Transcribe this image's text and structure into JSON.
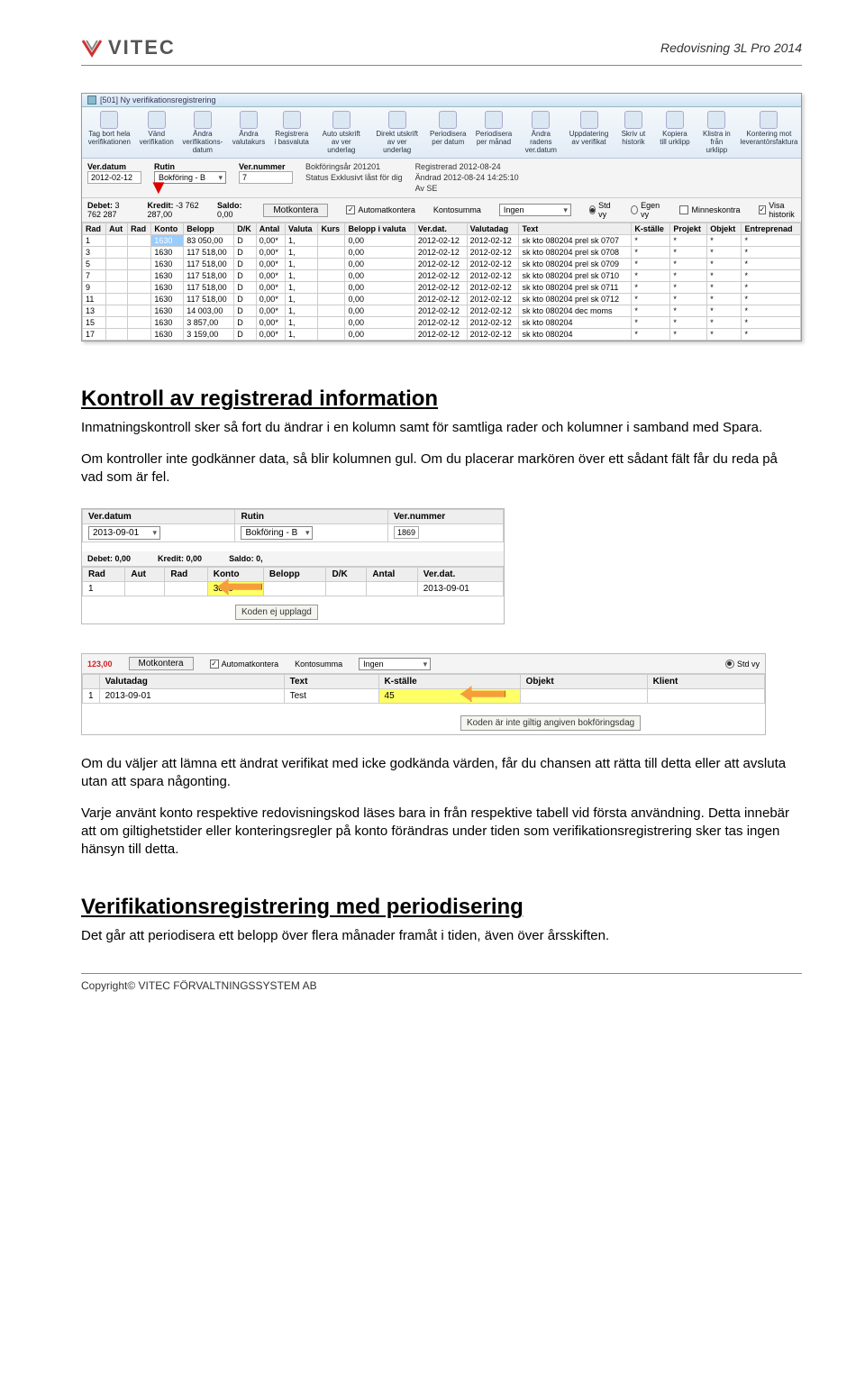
{
  "header": {
    "logo_text": "VITEC",
    "doc_title": "Redovisning 3L Pro 2014"
  },
  "screenshot1": {
    "window_title": "[501] Ny verifikationsregistrering",
    "toolbar": [
      "Tag bort hela verifikationen",
      "Vänd verifikation",
      "Ändra verifikations-datum",
      "Ändra valutakurs",
      "Registrera i basvaluta",
      "Auto utskrift av ver underlag",
      "Direkt utskrift av ver underlag",
      "Periodisera per datum",
      "Periodisera per månad",
      "Ändra radens ver.datum",
      "Uppdatering av verifikat",
      "Skriv ut historik",
      "Kopiera till urklipp",
      "Klistra in från urklipp",
      "Kontering mot leverantörsfaktura"
    ],
    "form": {
      "verdatum_label": "Ver.datum",
      "verdatum": "2012-02-12",
      "rutin_label": "Rutin",
      "rutin": "Bokföring - B",
      "vernummer_label": "Ver.nummer",
      "vernummer": "7",
      "bokforingsar_label": "Bokföringsår",
      "bokforingsar": "201201",
      "status_label": "Status",
      "status": "Exklusivt låst för dig",
      "registrerad_label": "Registrerad",
      "registrerad": "2012-08-24",
      "andrad_label": "Ändrad",
      "andrad": "2012-08-24 14:25:10",
      "av_label": "Av",
      "av": "SE"
    },
    "sumbar": {
      "debet_label": "Debet:",
      "debet": "3 762 287",
      "kredit_label": "Kredit:",
      "kredit": "-3 762 287,00",
      "saldo_label": "Saldo:",
      "saldo": "0,00",
      "motkontera": "Motkontera",
      "automatkontera": "Automatkontera",
      "kontosumma_label": "Kontosumma",
      "kontosumma_val": "Ingen",
      "stdvy": "Std vy",
      "egenvy": "Egen vy",
      "minneskontra": "Minneskontra",
      "visahistorik": "Visa historik"
    },
    "grid": {
      "cols": [
        "Rad",
        "Aut",
        "Rad",
        "Konto",
        "Belopp",
        "D/K",
        "Antal",
        "Valuta",
        "Kurs",
        "Belopp i valuta",
        "Ver.dat.",
        "Valutadag",
        "Text",
        "K-ställe",
        "Projekt",
        "Objekt",
        "Entreprenad"
      ],
      "rows": [
        {
          "rad": "1",
          "konto": "1630",
          "belopp": "83 050,00",
          "dk": "D",
          "antal": "0,00*",
          "valuta": "1,",
          "bival": "0,00",
          "verdat": "2012-02-12",
          "valdag": "2012-02-12",
          "text": "sk kto 080204 prel sk 0707"
        },
        {
          "rad": "3",
          "konto": "1630",
          "belopp": "117 518,00",
          "dk": "D",
          "antal": "0,00*",
          "valuta": "1,",
          "bival": "0,00",
          "verdat": "2012-02-12",
          "valdag": "2012-02-12",
          "text": "sk kto 080204 prel sk 0708"
        },
        {
          "rad": "5",
          "konto": "1630",
          "belopp": "117 518,00",
          "dk": "D",
          "antal": "0,00*",
          "valuta": "1,",
          "bival": "0,00",
          "verdat": "2012-02-12",
          "valdag": "2012-02-12",
          "text": "sk kto 080204 prel sk 0709"
        },
        {
          "rad": "7",
          "konto": "1630",
          "belopp": "117 518,00",
          "dk": "D",
          "antal": "0,00*",
          "valuta": "1,",
          "bival": "0,00",
          "verdat": "2012-02-12",
          "valdag": "2012-02-12",
          "text": "sk kto 080204 prel sk 0710"
        },
        {
          "rad": "9",
          "konto": "1630",
          "belopp": "117 518,00",
          "dk": "D",
          "antal": "0,00*",
          "valuta": "1,",
          "bival": "0,00",
          "verdat": "2012-02-12",
          "valdag": "2012-02-12",
          "text": "sk kto 080204 prel sk 0711"
        },
        {
          "rad": "11",
          "konto": "1630",
          "belopp": "117 518,00",
          "dk": "D",
          "antal": "0,00*",
          "valuta": "1,",
          "bival": "0,00",
          "verdat": "2012-02-12",
          "valdag": "2012-02-12",
          "text": "sk kto 080204 prel sk 0712"
        },
        {
          "rad": "13",
          "konto": "1630",
          "belopp": "14 003,00",
          "dk": "D",
          "antal": "0,00*",
          "valuta": "1,",
          "bival": "0,00",
          "verdat": "2012-02-12",
          "valdag": "2012-02-12",
          "text": "sk kto 080204 dec moms"
        },
        {
          "rad": "15",
          "konto": "1630",
          "belopp": "3 857,00",
          "dk": "D",
          "antal": "0,00*",
          "valuta": "1,",
          "bival": "0,00",
          "verdat": "2012-02-12",
          "valdag": "2012-02-12",
          "text": "sk kto 080204"
        },
        {
          "rad": "17",
          "konto": "1630",
          "belopp": "3 159,00",
          "dk": "D",
          "antal": "0,00*",
          "valuta": "1,",
          "bival": "0,00",
          "verdat": "2012-02-12",
          "valdag": "2012-02-12",
          "text": "sk kto 080204"
        }
      ]
    }
  },
  "section1": {
    "heading": "Kontroll av registrerad information",
    "p1": "Inmatningskontroll sker så fort du ändrar i en kolumn samt för samtliga rader och kolumner i samband med Spara.",
    "p2": "Om kontroller inte godkänner data, så blir kolumnen gul. Om du placerar markören över ett sådant fält får du reda på vad som är fel."
  },
  "screenshot2": {
    "verdatum_label": "Ver.datum",
    "verdatum": "2013-09-01",
    "rutin_label": "Rutin",
    "rutin": "Bokföring - B",
    "vernummer_label": "Ver.nummer",
    "vernummer": "1869",
    "debet_label": "Debet: 0,00",
    "kredit_label": "Kredit: 0,00",
    "saldo_label": "Saldo: 0,",
    "cols": [
      "Rad",
      "Aut",
      "Rad",
      "Konto",
      "Belopp",
      "D/K",
      "Antal",
      "Ver.dat."
    ],
    "row": {
      "rad": "1",
      "konto": "3000",
      "belopp": "",
      "dk": "",
      "antal": "",
      "verdat": "2013-09-01"
    },
    "tooltip": "Koden ej upplagd"
  },
  "screenshot3": {
    "left_val": "123,00",
    "motkontera": "Motkontera",
    "automatkontera": "Automatkontera",
    "kontosumma_label": "Kontosumma",
    "kontosumma_val": "Ingen",
    "stdvy": "Std vy",
    "cols": [
      "Valutadag",
      "Text",
      "K-ställe",
      "Objekt",
      "Klient"
    ],
    "row": {
      "nr": "1",
      "valutadag": "2013-09-01",
      "text": "Test",
      "kstalle": "45"
    },
    "tooltip": "Koden är inte giltig angiven bokföringsdag"
  },
  "section2": {
    "p1": "Om du väljer att lämna ett ändrat verifikat med icke godkända värden, får du chansen att rätta till detta eller att avsluta utan att spara någonting.",
    "p2": "Varje använt konto respektive redovisningskod läses bara in från respektive tabell vid första användning. Detta innebär att om giltighetstider eller konteringsregler på konto förändras under tiden som verifikationsregistrering sker tas ingen hänsyn till detta."
  },
  "section3": {
    "heading": "Verifikationsregistrering med periodisering",
    "p1": "Det går att periodisera ett belopp över flera månader framåt i tiden, även över årsskiften."
  },
  "footer": {
    "copyright": "Copyright© VITEC FÖRVALTNINGSSYSTEM AB"
  }
}
